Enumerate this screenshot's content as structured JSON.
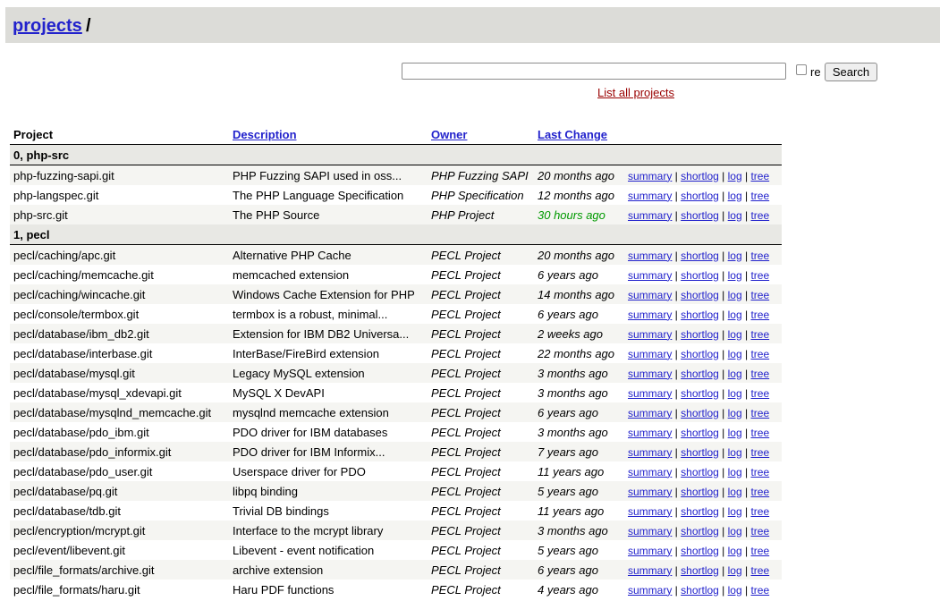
{
  "header": {
    "projects_link": "projects",
    "separator": "/"
  },
  "search": {
    "value": "",
    "re_label": "re",
    "button_label": "Search",
    "list_all_label": "List all projects"
  },
  "columns": {
    "project": "Project",
    "description": "Description",
    "owner": "Owner",
    "last_change": "Last Change"
  },
  "links": {
    "summary": "summary",
    "shortlog": "shortlog",
    "log": "log",
    "tree": "tree"
  },
  "groups": [
    {
      "name": "0, php-src",
      "rows": [
        {
          "project": "php-fuzzing-sapi.git",
          "description": "PHP Fuzzing SAPI used in oss...",
          "owner": "PHP Fuzzing SAPI",
          "age": "20 months ago"
        },
        {
          "project": "php-langspec.git",
          "description": "The PHP Language Specification",
          "owner": "PHP Specification",
          "age": "12 months ago"
        },
        {
          "project": "php-src.git",
          "description": "The PHP Source",
          "owner": "PHP Project",
          "age": "30 hours ago"
        }
      ]
    },
    {
      "name": "1, pecl",
      "rows": [
        {
          "project": "pecl/caching/apc.git",
          "description": "Alternative PHP Cache",
          "owner": "PECL Project",
          "age": "20 months ago"
        },
        {
          "project": "pecl/caching/memcache.git",
          "description": "memcached extension",
          "owner": "PECL Project",
          "age": "6 years ago"
        },
        {
          "project": "pecl/caching/wincache.git",
          "description": "Windows Cache Extension for PHP",
          "owner": "PECL Project",
          "age": "14 months ago"
        },
        {
          "project": "pecl/console/termbox.git",
          "description": "termbox is a robust, minimal...",
          "owner": "PECL Project",
          "age": "6 years ago"
        },
        {
          "project": "pecl/database/ibm_db2.git",
          "description": "Extension for IBM DB2 Universa...",
          "owner": "PECL Project",
          "age": "2 weeks ago"
        },
        {
          "project": "pecl/database/interbase.git",
          "description": "InterBase/FireBird extension",
          "owner": "PECL Project",
          "age": "22 months ago"
        },
        {
          "project": "pecl/database/mysql.git",
          "description": "Legacy MySQL extension",
          "owner": "PECL Project",
          "age": "3 months ago"
        },
        {
          "project": "pecl/database/mysql_xdevapi.git",
          "description": "MySQL X DevAPI",
          "owner": "PECL Project",
          "age": "3 months ago"
        },
        {
          "project": "pecl/database/mysqlnd_memcache.git",
          "description": "mysqlnd memcache extension",
          "owner": "PECL Project",
          "age": "6 years ago"
        },
        {
          "project": "pecl/database/pdo_ibm.git",
          "description": "PDO driver for IBM databases",
          "owner": "PECL Project",
          "age": "3 months ago"
        },
        {
          "project": "pecl/database/pdo_informix.git",
          "description": "PDO driver for IBM Informix...",
          "owner": "PECL Project",
          "age": "7 years ago"
        },
        {
          "project": "pecl/database/pdo_user.git",
          "description": "Userspace driver for PDO",
          "owner": "PECL Project",
          "age": "11 years ago"
        },
        {
          "project": "pecl/database/pq.git",
          "description": "libpq binding",
          "owner": "PECL Project",
          "age": "5 years ago"
        },
        {
          "project": "pecl/database/tdb.git",
          "description": "Trivial DB bindings",
          "owner": "PECL Project",
          "age": "11 years ago"
        },
        {
          "project": "pecl/encryption/mcrypt.git",
          "description": "Interface to the mcrypt library",
          "owner": "PECL Project",
          "age": "3 months ago"
        },
        {
          "project": "pecl/event/libevent.git",
          "description": "Libevent - event notification",
          "owner": "PECL Project",
          "age": "5 years ago"
        },
        {
          "project": "pecl/file_formats/archive.git",
          "description": "archive extension",
          "owner": "PECL Project",
          "age": "6 years ago"
        },
        {
          "project": "pecl/file_formats/haru.git",
          "description": "Haru PDF functions",
          "owner": "PECL Project",
          "age": "4 years ago"
        }
      ]
    }
  ],
  "colors": {
    "link": "#2222cc",
    "recent_age": "#009900",
    "list_all": "#990000",
    "header_bg": "#dcdcd8"
  }
}
